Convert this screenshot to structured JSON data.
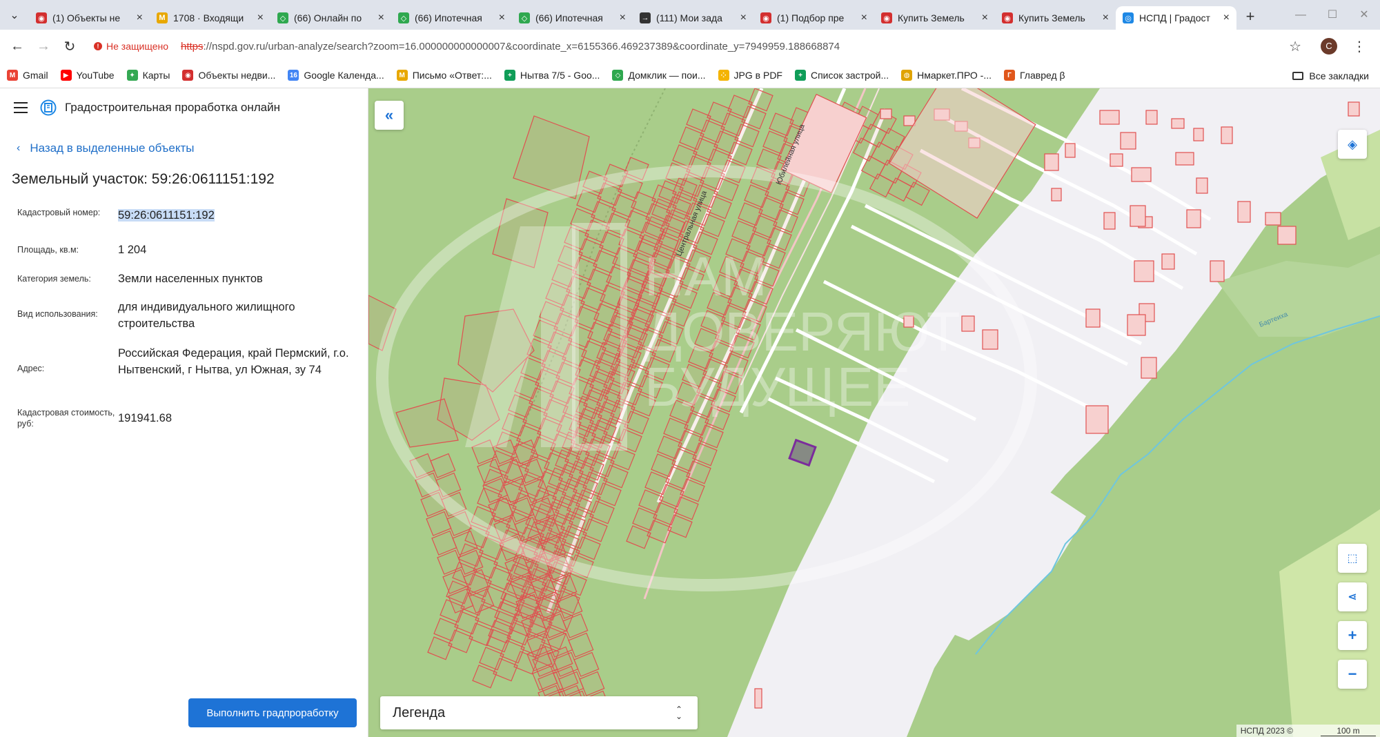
{
  "tabs": [
    {
      "title": "(1) Объекты не",
      "color": "#d32f2f",
      "glyph": "◉"
    },
    {
      "title": "1708 · Входящи",
      "color": "#e8a800",
      "glyph": "M"
    },
    {
      "title": "(66) Онлайн по",
      "color": "#2fa84f",
      "glyph": "◇"
    },
    {
      "title": "(66) Ипотечная",
      "color": "#2fa84f",
      "glyph": "◇"
    },
    {
      "title": "(66) Ипотечная",
      "color": "#2fa84f",
      "glyph": "◇"
    },
    {
      "title": "(111) Мои зада",
      "color": "#333333",
      "glyph": "→"
    },
    {
      "title": "(1) Подбор пре",
      "color": "#d32f2f",
      "glyph": "◉"
    },
    {
      "title": "Купить Земель",
      "color": "#d32f2f",
      "glyph": "◉"
    },
    {
      "title": "Купить Земель",
      "color": "#d32f2f",
      "glyph": "◉"
    },
    {
      "title": "НСПД | Градост",
      "color": "#1e88e5",
      "glyph": "◎",
      "active": true
    }
  ],
  "address": {
    "security": "Не защищено",
    "proto": "https",
    "url": "://nspd.gov.ru/urban-analyze/search?zoom=16.000000000000007&coordinate_x=6155366.469237389&coordinate_y=7949959.188668874",
    "profile_initial": "C"
  },
  "bookmarks": [
    {
      "label": "Gmail",
      "color": "#ea4335",
      "glyph": "M"
    },
    {
      "label": "YouTube",
      "color": "#ff0000",
      "glyph": "▶"
    },
    {
      "label": "Карты",
      "color": "#34a853",
      "glyph": "✦"
    },
    {
      "label": "Объекты недви...",
      "color": "#d32f2f",
      "glyph": "◉"
    },
    {
      "label": "Google Календа...",
      "color": "#4285f4",
      "glyph": "16"
    },
    {
      "label": "Письмо «Ответ:...",
      "color": "#e8a800",
      "glyph": "M"
    },
    {
      "label": "Нытва 7/5 - Goo...",
      "color": "#0f9d58",
      "glyph": "+"
    },
    {
      "label": "Домклик — пои...",
      "color": "#2fa84f",
      "glyph": "◇"
    },
    {
      "label": "JPG в PDF",
      "color": "#f4b400",
      "glyph": "⁘"
    },
    {
      "label": "Список застрой...",
      "color": "#0f9d58",
      "glyph": "+"
    },
    {
      "label": "Нмаркет.ПРО -...",
      "color": "#e0a300",
      "glyph": "◍"
    },
    {
      "label": "Главред β",
      "color": "#e0571c",
      "glyph": "Г"
    }
  ],
  "bookmarks_all": "Все закладки",
  "panel": {
    "app_title": "Градостроительная проработка онлайн",
    "back_label": "Назад в выделенные объекты",
    "object_title": "Земельный участок: 59:26:0611151:192",
    "attrs": [
      {
        "key": "Кадастровый номер:",
        "value": "59:26:0611151:192"
      },
      {
        "key": "Площадь, кв.м:",
        "value": "1 204"
      },
      {
        "key": "Категория земель:",
        "value": "Земли населенных пунктов"
      },
      {
        "key": "Вид использования:",
        "value": "для индивидуального жилищного строительства"
      },
      {
        "key": "Адрес:",
        "value": "Российская Федерация, край Пермский, г.о. Нытвенский, г Нытва, ул Южная, зу 74"
      },
      {
        "key": "Кадастровая стоимость, руб:",
        "value": "191941.68"
      }
    ],
    "submit_label": "Выполнить градпроработку"
  },
  "map": {
    "legend_label": "Легенда",
    "street_1": "Центральная улица",
    "street_2": "Юбилейная улица",
    "river": "Бартеиха",
    "copyright": "НСПД 2023 ©",
    "scale": "100 m",
    "watermark_line1": "НАМ",
    "watermark_line2": "ДОВЕРЯЮТ",
    "watermark_line3": "БУДУЩЕЕ",
    "colors": {
      "forest": "#a9cd8a",
      "urban": "#f1f0f4",
      "parcel_stroke": "#e05050",
      "selected": "#7b2c9c",
      "river": "#6fc6de",
      "accent": "#1e73d6"
    }
  }
}
